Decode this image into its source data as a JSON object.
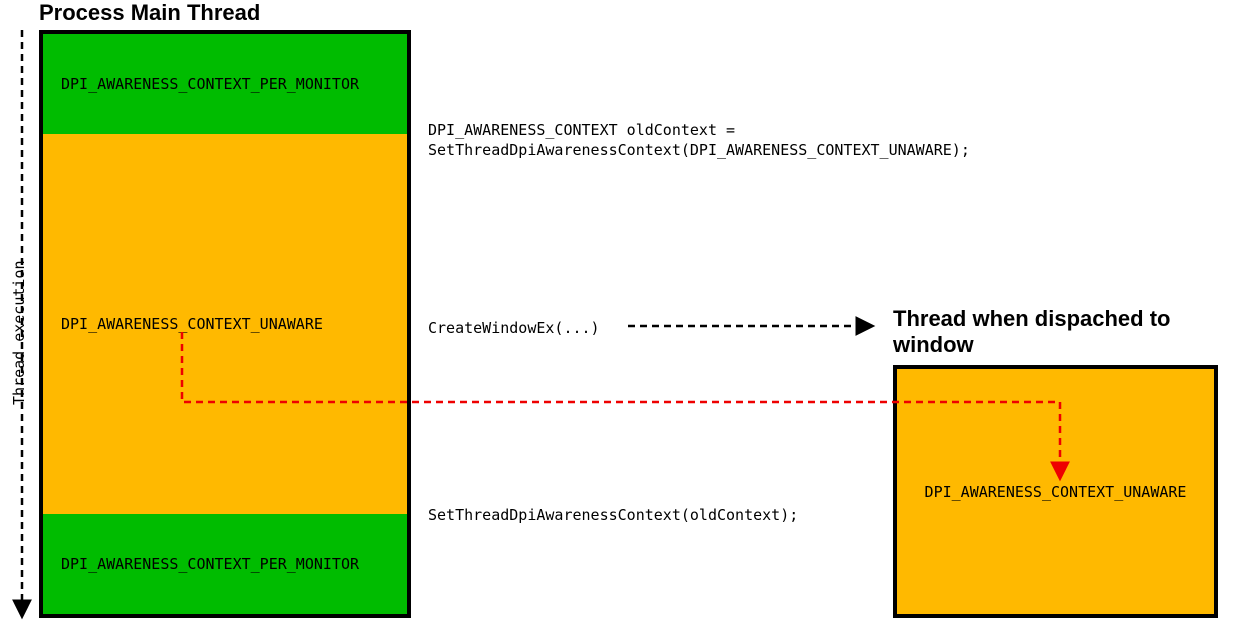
{
  "titles": {
    "main": "Process Main Thread",
    "window": "Thread when dispached to window"
  },
  "labels": {
    "threadExec": "Thread execution",
    "perMonitor": "DPI_AWARENESS_CONTEXT_PER_MONITOR",
    "unaware": "DPI_AWARENESS_CONTEXT_UNAWARE",
    "unaware2": "DPI_AWARENESS_CONTEXT_UNAWARE"
  },
  "code": {
    "setOld": "DPI_AWARENESS_CONTEXT oldContext =\nSetThreadDpiAwarenessContext(DPI_AWARENESS_CONTEXT_UNAWARE);",
    "create": "CreateWindowEx(...)",
    "restore": "SetThreadDpiAwarenessContext(oldContext);"
  }
}
